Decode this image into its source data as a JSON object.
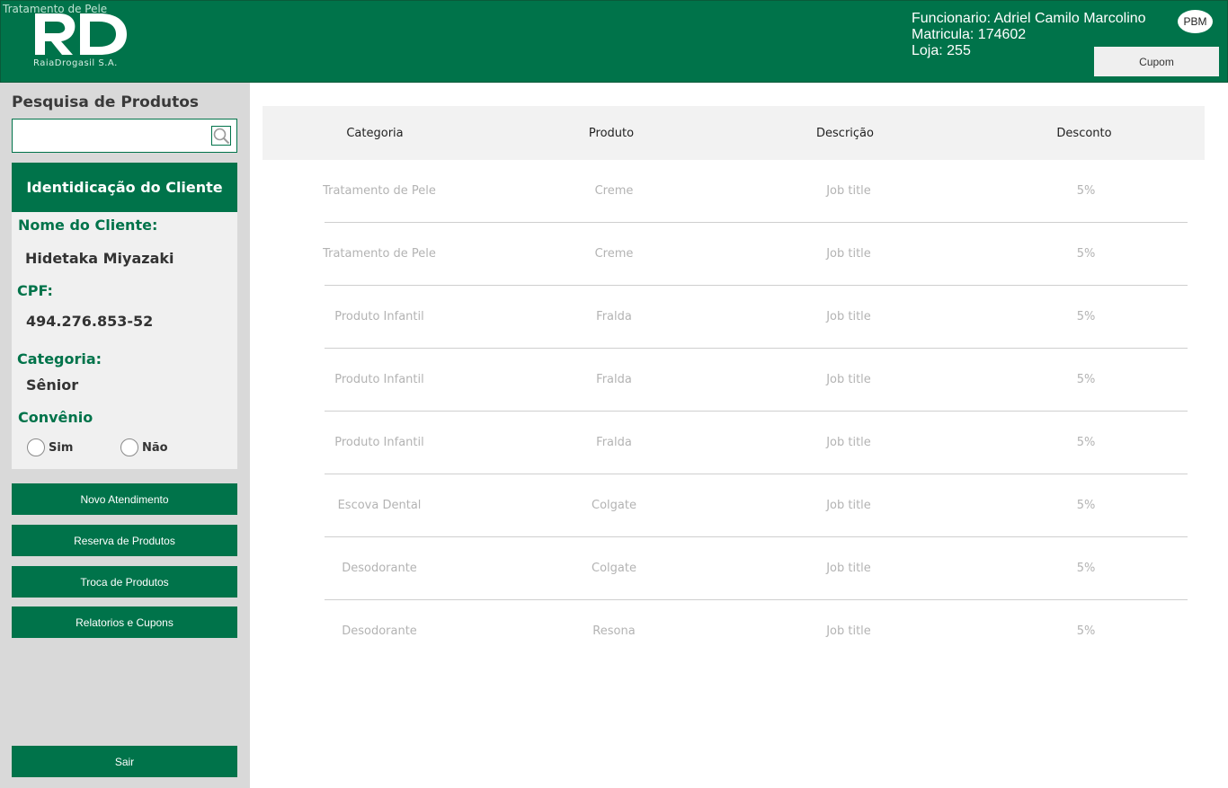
{
  "header": {
    "overlap_text": "Tratamento de Pele",
    "logo_text": "RaiaDrogasil S.A.",
    "employee_name": "Funcionario: Adriel Camilo Marcolino",
    "employee_id": "Matricula: 174602",
    "store": "Loja: 255",
    "pbm_label": "PBM",
    "cupom_label": "Cupom"
  },
  "sidebar": {
    "search_title": "Pesquisa de Produtos",
    "search_value": "",
    "client_panel_title": "Identidicação do Cliente",
    "name_label": "Nome do Cliente:",
    "name_value": "Hidetaka Miyazaki",
    "cpf_label": "CPF:",
    "cpf_value": "494.276.853-52",
    "category_label": "Categoria:",
    "category_value": "Sênior",
    "agreement_label": "Convênio",
    "agreement_options": [
      "Sim",
      "Não"
    ],
    "buttons": [
      "Novo Atendimento",
      "Reserva de Produtos",
      "Troca de Produtos",
      "Relatorios e Cupons"
    ],
    "exit_label": "Sair"
  },
  "table": {
    "columns": [
      "Categoria",
      "Produto",
      "Descrição",
      "Desconto"
    ],
    "rows": [
      [
        "Tratamento de Pele",
        "Creme",
        "Job title",
        "5%"
      ],
      [
        "Tratamento de Pele",
        "Creme",
        "Job title",
        "5%"
      ],
      [
        "Produto Infantil",
        "Fralda",
        "Job title",
        "5%"
      ],
      [
        "Produto Infantil",
        "Fralda",
        "Job title",
        "5%"
      ],
      [
        "Produto Infantil",
        "Fralda",
        "Job title",
        "5%"
      ],
      [
        "Escova Dental",
        "Colgate",
        "Job title",
        "5%"
      ],
      [
        "Desodorante",
        "Colgate",
        "Job title",
        "5%"
      ],
      [
        "Desodorante",
        "Resona",
        "Job title",
        "5%"
      ]
    ]
  },
  "colors": {
    "brand_green": "#00734a",
    "sidebar_gray": "#d9d9d9",
    "panel_gray": "#f0f0f0"
  }
}
